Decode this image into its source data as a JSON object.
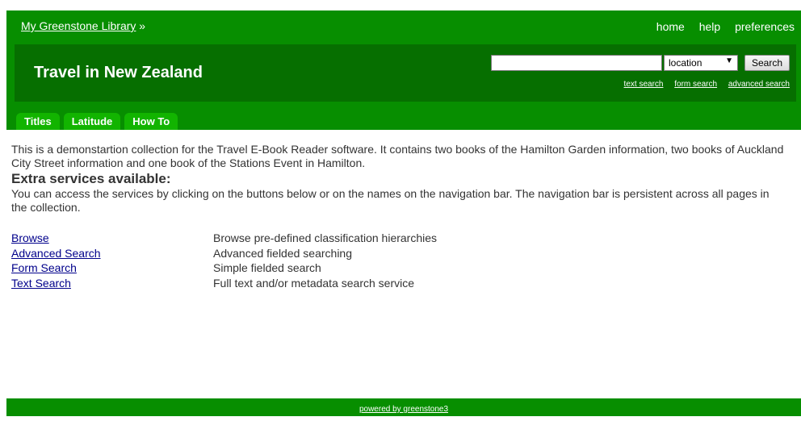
{
  "header": {
    "library_link": "My Greenstone Library",
    "library_suffix": "»",
    "nav": {
      "home": "home",
      "help": "help",
      "preferences": "preferences"
    }
  },
  "banner": {
    "collection_title": "Travel in New Zealand",
    "search": {
      "input_value": "",
      "field_selected": "location",
      "button_label": "Search",
      "links": {
        "text_search": "text search",
        "form_search": "form search",
        "advanced_search": "advanced search"
      }
    }
  },
  "tabs": [
    "Titles",
    "Latitude",
    "How To"
  ],
  "content": {
    "description": "This is a demonstartion collection for the Travel E-Book Reader software. It contains two books of the Hamilton Garden information, two books of Auckland City Street information and one book of the Stations Event in Hamilton.",
    "extra_heading": "Extra services available:",
    "extra_text": "You can access the services by clicking on the buttons below or on the names on the navigation bar. The navigation bar is persistent across all pages in the collection.",
    "services": [
      {
        "name": "Browse",
        "description": "Browse pre-defined classification hierarchies"
      },
      {
        "name": "Advanced Search",
        "description": "Advanced fielded searching"
      },
      {
        "name": "Form Search",
        "description": "Simple fielded search"
      },
      {
        "name": "Text Search",
        "description": "Full text and/or metadata search service"
      }
    ]
  },
  "footer": {
    "powered_by": "powered by greenstone3"
  },
  "colors": {
    "header_green": "#078e00",
    "banner_green": "#066f00",
    "tab_green": "#12b400",
    "link_blue": "#00008b"
  }
}
